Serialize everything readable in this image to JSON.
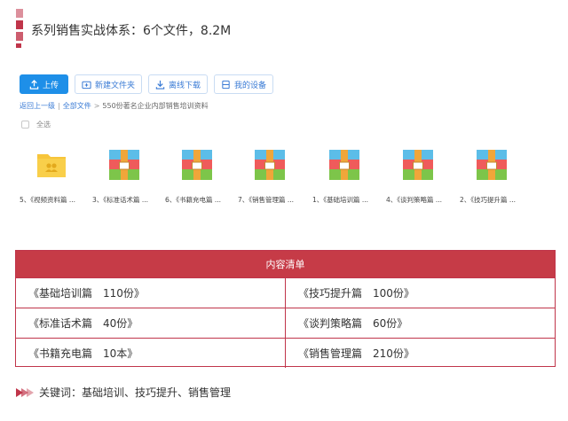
{
  "header": {
    "title": "系列销售实战体系：6个文件，8.2M"
  },
  "toolbar": {
    "upload_label": "上传",
    "new_folder_label": "新建文件夹",
    "offline_download_label": "离线下载",
    "my_devices_label": "我的设备"
  },
  "breadcrumb": {
    "back_label": "返回上一级",
    "all_files_label": "全部文件",
    "separator": ">",
    "current_folder": "550份著名企业内部销售培训资料"
  },
  "select_all_label": "全选",
  "files": [
    {
      "name": "5、《视频资料篇 ...",
      "icon": "folder-icon"
    },
    {
      "name": "3、《标准话术篇 ...",
      "icon": "archive-icon"
    },
    {
      "name": "6、《书籍充电篇 ...",
      "icon": "archive-icon"
    },
    {
      "name": "7、《销售管理篇 ...",
      "icon": "archive-icon"
    },
    {
      "name": "1、《基础培训篇 ...",
      "icon": "archive-icon"
    },
    {
      "name": "4、《谈判策略篇 ...",
      "icon": "archive-icon"
    },
    {
      "name": "2、《技巧提升篇 ...",
      "icon": "archive-icon"
    }
  ],
  "content_table": {
    "header": "内容清单",
    "rows": [
      {
        "left": "《基础培训篇　110份》",
        "right": "《技巧提升篇　100份》"
      },
      {
        "left": "《标准话术篇　40份》",
        "right": "《谈判策略篇　60份》"
      },
      {
        "left": "《书籍充电篇　10本》",
        "right": "《销售管理篇　210份》"
      }
    ]
  },
  "keywords": {
    "text": "关键词：基础培训、技巧提升、销售管理"
  },
  "colors": {
    "accent": "#c63b47",
    "link": "#3a7bd5",
    "primary_button": "#1e8fe8"
  }
}
